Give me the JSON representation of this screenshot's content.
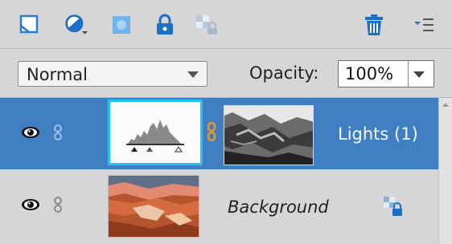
{
  "toolbar": {
    "icons": [
      "new-layer-icon",
      "adjustment-layer-icon",
      "layer-mask-icon",
      "lock-all-icon",
      "lock-transparency-icon",
      "delete-layer-icon",
      "panel-menu-icon"
    ]
  },
  "options": {
    "blend_mode": "Normal",
    "opacity_label": "Opacity:",
    "opacity_value": "100%"
  },
  "layers": [
    {
      "name": "Lights (1)",
      "selected": true,
      "visible": true
    },
    {
      "name": "Background",
      "selected": false,
      "visible": true,
      "locked": true
    }
  ],
  "colors": {
    "panel_bg": "#d6d6d6",
    "selected_row": "#3f7fc1",
    "accent_blue": "#1c7fd4",
    "thumb_border": "#1ec4f2",
    "chain_orange": "#e89a1e"
  }
}
